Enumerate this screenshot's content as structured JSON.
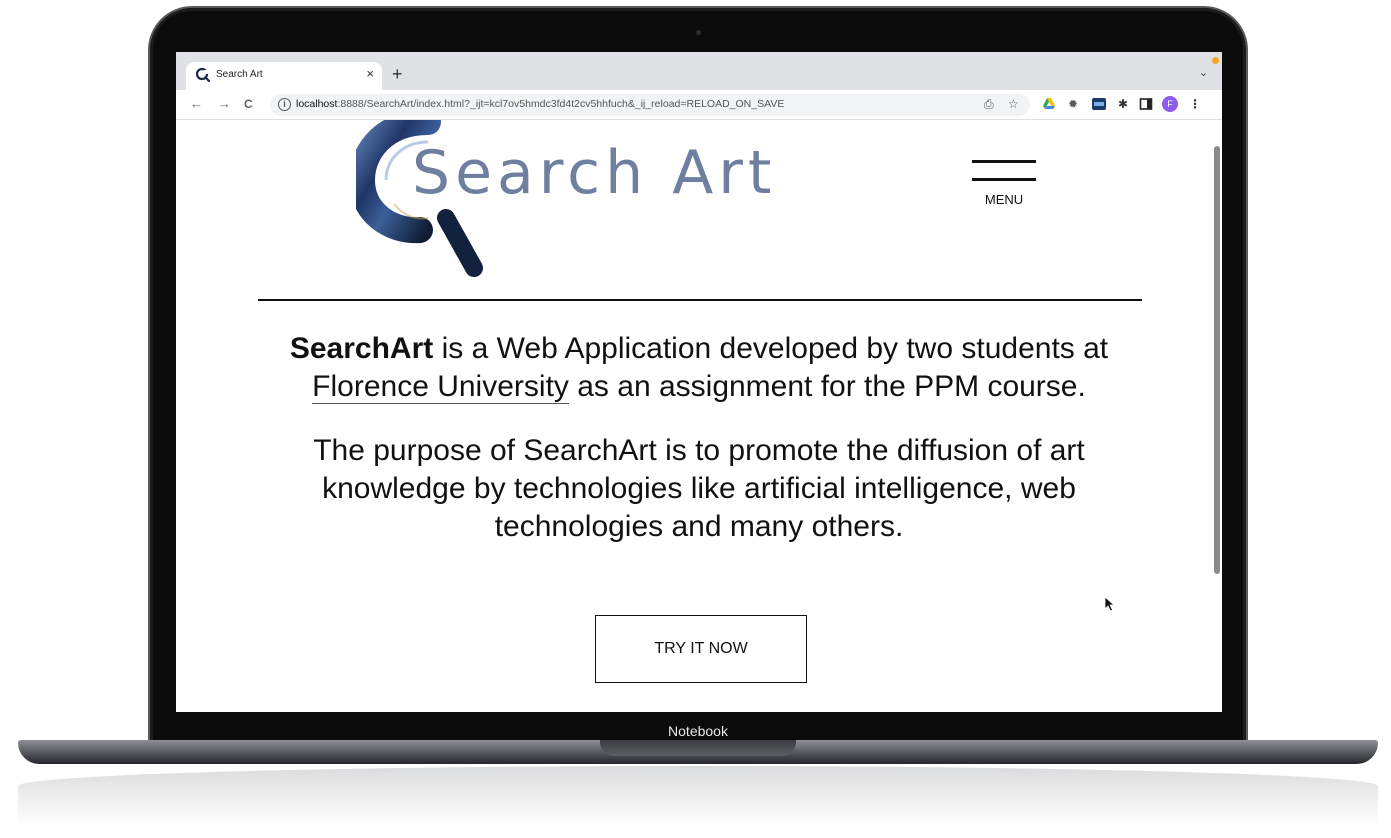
{
  "device": {
    "bezel_label": "Notebook"
  },
  "browser": {
    "tab": {
      "title": "Search Art",
      "close_glyph": "×",
      "icon": "search-art-favicon"
    },
    "new_tab_glyph": "+",
    "tab_list_glyph": "⌄",
    "nav": {
      "back_glyph": "←",
      "forward_glyph": "→",
      "reload_glyph": "C"
    },
    "url": {
      "host": "localhost",
      "rest": ":8888/SearchArt/index.html?_ijt=kcl7ov5hmdc3fd4t2cv5hhfuch&_ij_reload=RELOAD_ON_SAVE",
      "info_glyph": "i"
    },
    "profile_initial": "F"
  },
  "site": {
    "logo_text": "Search Art",
    "menu_label": "MENU",
    "intro": {
      "brand": "SearchArt",
      "part1": " is a Web Application developed by two students at ",
      "link": "Florence University",
      "part2": " as an assignment for the PPM course."
    },
    "purpose": "The purpose of SearchArt is to promote the diffusion of art knowledge by technologies like artificial intelligence, web technologies and many others.",
    "cta_label": "TRY IT NOW"
  },
  "colors": {
    "logo_blue": "#6e7fa0",
    "logo_navy": "#1f3566",
    "profile_purple": "#8e5ce8",
    "drive_green": "#34a853",
    "drive_yellow": "#fbbc04",
    "drive_blue": "#4285f4"
  }
}
